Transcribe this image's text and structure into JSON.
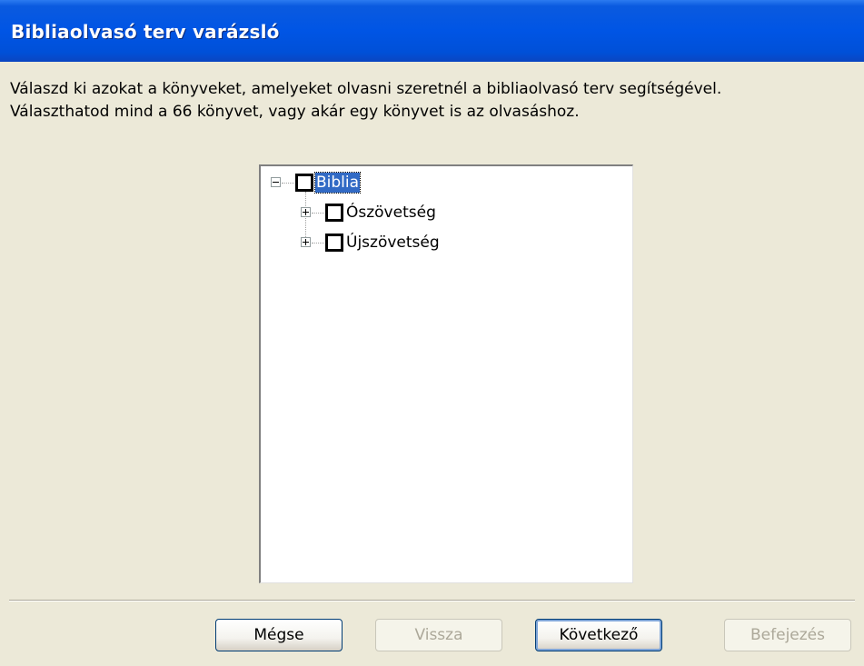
{
  "window": {
    "title": "Bibliaolvasó terv varázsló"
  },
  "description": {
    "line1": "Válaszd ki azokat a könyveket, amelyeket olvasni szeretnél a bibliaolvasó terv segítségével.",
    "line2": "Választhatod mind a 66 könyvet, vagy akár egy könyvet is az olvasáshoz."
  },
  "tree": {
    "root": {
      "label": "Biblia",
      "expanded": true,
      "checked": false,
      "selected": true
    },
    "children": [
      {
        "label": "Ószövetség",
        "expanded": false,
        "checked": false
      },
      {
        "label": "Újszövetség",
        "expanded": false,
        "checked": false
      }
    ]
  },
  "buttons": {
    "cancel": "Mégse",
    "back": "Vissza",
    "next": "Következő",
    "finish": "Befejezés"
  },
  "colors": {
    "title_bar": "#0055e5",
    "dialog_bg": "#ece9d8",
    "selection": "#316ac5"
  }
}
